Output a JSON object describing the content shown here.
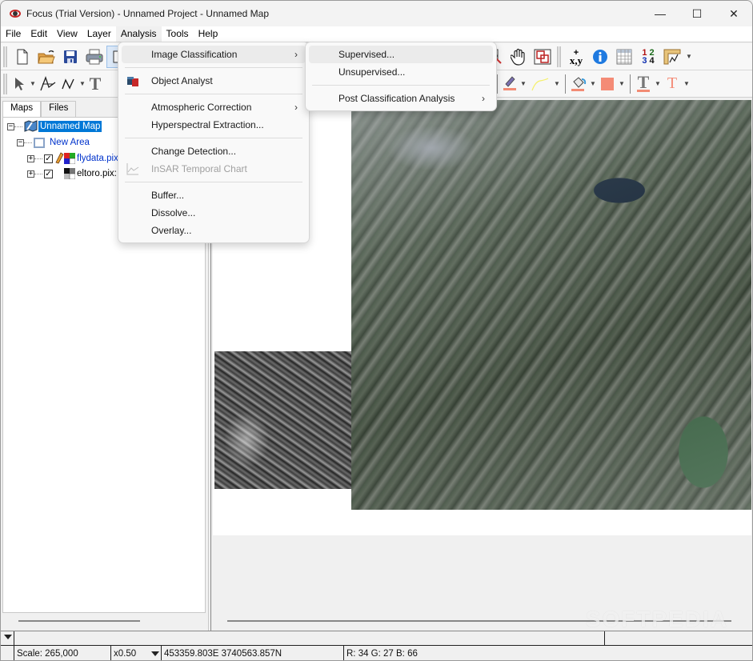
{
  "window": {
    "title": "Focus (Trial Version) - Unnamed Project - Unnamed Map",
    "controls": {
      "minimize": "—",
      "maximize": "☐",
      "close": "✕"
    }
  },
  "menubar": {
    "items": [
      "File",
      "Edit",
      "View",
      "Layer",
      "Analysis",
      "Tools",
      "Help"
    ],
    "active": "Analysis"
  },
  "toolbar_row1": {
    "buttons": [
      "new-file",
      "open-folder",
      "save",
      "print",
      "select-area",
      "zoom",
      "pan",
      "overview",
      "coordinate-xy",
      "info",
      "table",
      "numbers-1234",
      "ruler-graph"
    ],
    "coord_label": "x,y",
    "numbers_label_top": "1 2",
    "numbers_label_bottom": "3 4"
  },
  "toolbar_row2": {
    "buttons": [
      "pointer",
      "vertex-edit",
      "polyline",
      "text",
      "line-color",
      "pen",
      "curve",
      "fill-bucket",
      "fill-color",
      "text-style",
      "text-color"
    ],
    "text_glyph": "T",
    "colors": {
      "line": "#f28b74",
      "fill": "#f48b76",
      "text": "#f48b76",
      "curve": "#f5f06a"
    }
  },
  "left_panel": {
    "tabs": [
      "Maps",
      "Files"
    ],
    "active_tab": "Maps",
    "tree": [
      {
        "label": "Unnamed Map",
        "level": 0,
        "expander": "−",
        "selected": true
      },
      {
        "label": "New Area",
        "level": 1,
        "expander": "−"
      },
      {
        "label": "flydata.pix",
        "level": 2,
        "expander": "+",
        "checked": true
      },
      {
        "label": "eltoro.pix:",
        "level": 2,
        "expander": "+",
        "checked": true
      }
    ]
  },
  "analysis_menu": {
    "items": [
      {
        "label": "Image Classification",
        "submenu": true,
        "hover": true
      },
      {
        "separator": true
      },
      {
        "label": "Object Analyst",
        "icon": "object-analyst-icon"
      },
      {
        "separator": true
      },
      {
        "label": "Atmospheric Correction",
        "submenu": true
      },
      {
        "label": "Hyperspectral Extraction..."
      },
      {
        "separator": true
      },
      {
        "label": "Change Detection..."
      },
      {
        "label": "InSAR Temporal Chart",
        "disabled": true,
        "icon": "line-chart-icon"
      },
      {
        "separator": true
      },
      {
        "label": "Buffer..."
      },
      {
        "label": "Dissolve..."
      },
      {
        "label": "Overlay..."
      }
    ]
  },
  "classification_submenu": {
    "items": [
      {
        "label": "Supervised...",
        "hover": true
      },
      {
        "label": "Unsupervised..."
      },
      {
        "separator": true
      },
      {
        "label": "Post Classification Analysis",
        "submenu": true
      }
    ]
  },
  "statusbar": {
    "scale": "Scale: 265,000",
    "zoom": "x0.50",
    "coordinates": "453359.803E 3740563.857N",
    "pixel_value": "R: 34 G: 27 B: 66"
  },
  "watermark": "SOFTPEDIA"
}
